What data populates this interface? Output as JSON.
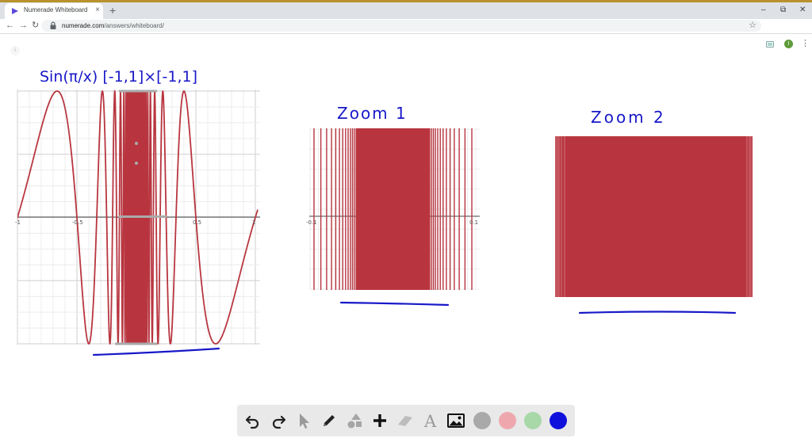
{
  "browser": {
    "tab_title": "Numerade Whiteboard",
    "tab_close": "×",
    "new_tab": "+",
    "url_host": "numerade.com",
    "url_path": "/answers/whiteboard/",
    "profile_initial": "I",
    "controls": {
      "minimize": "–",
      "restore": "⧉",
      "close": "✕",
      "back": "←",
      "forward": "→",
      "reload": "↻",
      "star": "☆",
      "menu": "⋮"
    }
  },
  "page": {
    "info_glyph": "i"
  },
  "whiteboard": {
    "handwriting": {
      "main_title": "Sin(π/x) [-1,1]×[-1,1]",
      "zoom1_title": "Zoom 1",
      "zoom2_title": "Zoom 2"
    },
    "graph": {
      "function": "sin(pi/x)",
      "x_range": [
        -1,
        1
      ],
      "y_range": [
        -1,
        1
      ],
      "x_tick_labels": [
        "-1",
        "-0.5",
        "0.5",
        "1"
      ],
      "zoom1_tick_labels": [
        "-0.1",
        "0.1"
      ],
      "curve_color": "#b8353f"
    },
    "tools": [
      {
        "name": "undo-icon"
      },
      {
        "name": "redo-icon"
      },
      {
        "name": "pointer-icon"
      },
      {
        "name": "pencil-icon"
      },
      {
        "name": "shapes-icon"
      },
      {
        "name": "plus-icon"
      },
      {
        "name": "eraser-icon"
      },
      {
        "name": "text-icon",
        "glyph": "A"
      },
      {
        "name": "image-icon"
      }
    ],
    "colors": [
      "#a9a9a9",
      "#eea8ad",
      "#a8d8a8",
      "#1010dd"
    ]
  }
}
